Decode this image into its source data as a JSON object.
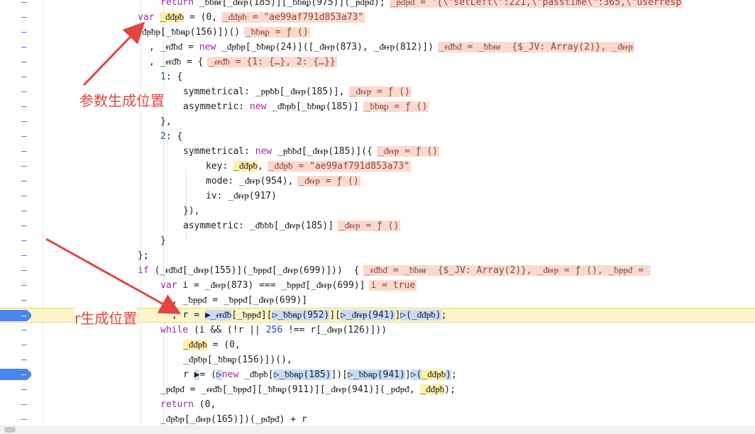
{
  "gutter_marker": "–",
  "lines": [
    {
      "indent": 226,
      "html": "<span class=\"kw\">return</span> _ᵬᵬᵰᵲ[_ᵭᵲᵳᵽ(185)][_ᵬᵬᵰᵱ(975)](_ᵽᵭᵽᵭ);",
      "inline": "_ᵽᵭᵽᵭ = \"{\\\"setLeft\\\":221,\\\"passtime\\\":365,\\\"userresp"
    },
    {
      "indent": 194,
      "html": "<span class=\"kw\">var</span> <span class=\"sel\">_ᵭᵭᵽᵬ</span> = (0,",
      "inline": "_ᵭᵭᵽᵬ = \"ae99af791d853a73\""
    },
    {
      "indent": 200,
      "html": "ᵭᵽᵬᵽ[_ᵬᵬᵰᵱ(156)])()",
      "inline": "_ᵬᵬᵰᵱ = ƒ ()"
    },
    {
      "indent": 210,
      "html": ", _ᵲᵭᵬᵭ = <span class=\"kw\">new</span> _ᵭᵽᵬᵽ[_ᵬᵬᵰᵱ(24)]([_ᵭᵲᵳᵽ(873), _ᵭᵲᵳᵽ(812)])",
      "inline": "_ᵲᵭᵬᵭ = _ᵬᵬᵰᵲ  {$_JV: Array(2)}, _ᵭᵲᵳᵽ"
    },
    {
      "indent": 210,
      "html": ", _ᵳᵲᵭᵬ = {",
      "inline": "_ᵳᵲᵭᵬ = {1: {…}, 2: {…}}"
    },
    {
      "indent": 226,
      "html": "<span class=\"num\">1</span>: {",
      "inline": ""
    },
    {
      "indent": 258,
      "html": "symmetrical: _ᵽᵽᵬᵬ[_ᵭᵲᵳᵽ(185)],",
      "inline": "_ᵭᵲᵳᵽ = ƒ ()"
    },
    {
      "indent": 258,
      "html": "asymmetric: <span class=\"kw\">new</span> _ᵭᵬᵽᵬ[_ᵬᵬᵰᵱ(185)]",
      "inline": "_ᵬᵬᵰᵱ = ƒ ()"
    },
    {
      "indent": 226,
      "html": "},",
      "inline": ""
    },
    {
      "indent": 226,
      "html": "<span class=\"num\">2</span>: {",
      "inline": ""
    },
    {
      "indent": 258,
      "html": "symmetrical: <span class=\"kw\">new</span> _ᵽᵬᵬᵭ[_ᵭᵲᵳᵽ(185)]({",
      "inline": "_ᵭᵲᵳᵽ = ƒ ()"
    },
    {
      "indent": 290,
      "html": "key: <span class=\"sel\">_ᵭᵭᵽᵬ</span>,",
      "inline": "_ᵭᵭᵽᵬ = \"ae99af791d853a73\""
    },
    {
      "indent": 290,
      "html": "mode: _ᵭᵲᵳᵽ(954),",
      "inline": "_ᵭᵲᵳᵽ = ƒ ()"
    },
    {
      "indent": 290,
      "html": "iv: _ᵭᵲᵳᵽ(917)",
      "inline": ""
    },
    {
      "indent": 258,
      "html": "}),",
      "inline": ""
    },
    {
      "indent": 258,
      "html": "asymmetric: _ᵭᵬᵬᵬ[_ᵭᵲᵳᵽ(185)]",
      "inline": "_ᵭᵲᵳᵽ = ƒ ()"
    },
    {
      "indent": 226,
      "html": "}",
      "inline": ""
    },
    {
      "indent": 194,
      "html": "};",
      "inline": ""
    },
    {
      "indent": 194,
      "html": "<span class=\"kw\">if</span> (_ᵲᵭᵬᵭ[_ᵭᵲᵳᵽ(155)](_ᵬᵽᵽᵭ[_ᵭᵲᵳᵽ(699)]))  {",
      "inline": "_ᵲᵭᵬᵭ = _ᵬᵬᵰᵲ  {$_JV: Array(2)}, _ᵭᵲᵳᵽ = ƒ (), _ᵬᵽᵽᵭ = "
    },
    {
      "indent": 226,
      "html": "<span class=\"kw\">var</span> i = _ᵭᵲᵳᵽ(873) === _ᵬᵽᵽᵭ[_ᵭᵲᵳᵽ(699)]",
      "inline": "i = true"
    },
    {
      "indent": 242,
      "html": ", _ᵬᵽᵽᵭ = _ᵬᵽᵽᵭ[_ᵭᵲᵳᵽ(699)]",
      "inline": ""
    },
    {
      "indent": 242,
      "html": ", r = <span class=\"blu\">&#9654;_ᵳᵲᵭᵬ</span>[_ᵬᵽᵽᵭ][<span class=\"blu\">&#9655;_ᵬᵬᵰᵱ(952)</span>][<span class=\"blu\">&#9655;_ᵭᵲᵳᵽ(941)</span>]<span class=\"blu\">&#9655;(_ᵭᵭᵽᵬ)</span>;",
      "inline": "",
      "hl": true
    },
    {
      "indent": 226,
      "html": "<span class=\"kw\">while</span> (i &amp;&amp; (!r || <span class=\"num\">256</span> !== r[_ᵭᵲᵳᵽ(126)]))",
      "inline": ""
    },
    {
      "indent": 258,
      "html": "<span class=\"sel\">_ᵭᵭᵽᵬ</span> = (0,",
      "inline": ""
    },
    {
      "indent": 258,
      "html": "_ᵭᵽᵬᵽ[_ᵬᵬᵰᵱ(156)])(),",
      "inline": ""
    },
    {
      "indent": 258,
      "html": "r <span class=\"blu\">&#9654;</span>= (<span class=\"blu\">&#9655;</span><span class=\"kw\">new</span> _ᵭᵬᵽᵬ[<span class=\"blu\">&#9655;_ᵬᵬᵰᵱ(185)</span>])[<span class=\"blu\">&#9655;_ᵬᵬᵰᵱ(941)</span>]<span class=\"blu\">&#9655;(<span class=\"sel\">_ᵭᵭᵽᵬ</span>)</span>;",
      "inline": "",
      "bp": true
    },
    {
      "indent": 226,
      "html": "_ᵽᵭᵽᵭ = _ᵳᵲᵭᵬ[_ᵬᵽᵽᵭ][_ᵬᵬᵰᵱ(911)][_ᵭᵲᵳᵽ(941)](_ᵽᵭᵽᵭ, <span class=\"sel\">_ᵭᵭᵽᵬ</span>);",
      "inline": ""
    },
    {
      "indent": 226,
      "html": "<span class=\"kw\">return</span> (0,",
      "inline": ""
    },
    {
      "indent": 226,
      "html": "_ᵭᵽᵬᵽ[_ᵭᵲᵳᵽ(165)])(_ᵽᵭᵽᵭ) + r",
      "inline": ""
    }
  ],
  "annotations": {
    "param_label": "参数生成位置",
    "r_label": "r生成位置"
  },
  "colors": {
    "accent_red": "#e0453f",
    "breakpoint_blue": "#4a86f0",
    "highlight_yellow": "#fcf5c8"
  }
}
